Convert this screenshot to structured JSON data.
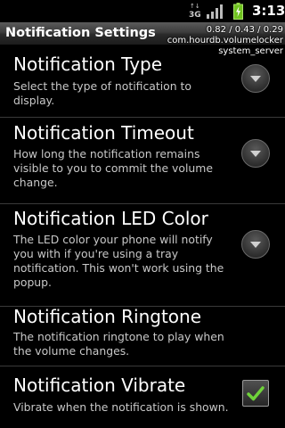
{
  "status_bar": {
    "network_type": "3G",
    "network_arrows": "↑↓",
    "time": "3:13"
  },
  "header": {
    "title": "Notification Settings",
    "load_overlay": "0.82 / 0.43 / 0.29",
    "process_1": "com.hourdb.volumelocker",
    "process_2": "system_server"
  },
  "preferences": [
    {
      "title": "Notification Type",
      "summary": "Select the type of notification to display.",
      "widget": "dropdown-icon"
    },
    {
      "title": "Notification Timeout",
      "summary": "How long the notification remains visible to you to commit the volume change.",
      "widget": "dropdown-icon"
    },
    {
      "title": "Notification LED Color",
      "summary": "The LED color your phone will notify you with if you're using a tray notification. This won't work using the popup.",
      "widget": "dropdown-icon"
    },
    {
      "title": "Notification Ringtone",
      "summary": "The notification ringtone to play when the volume changes.",
      "widget": "none"
    },
    {
      "title": "Notification Vibrate",
      "summary": "Vibrate when the notification is shown.",
      "widget": "checkbox",
      "checked": true
    }
  ],
  "colors": {
    "background": "#000000",
    "summary_text": "#c8c8c8",
    "check_green": "#6fd23a",
    "battery_green": "#8ed63c"
  }
}
